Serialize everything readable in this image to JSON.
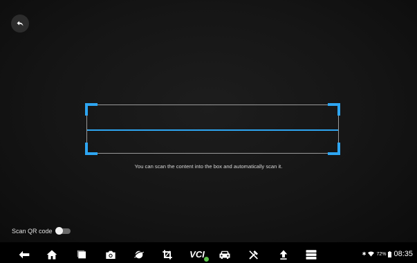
{
  "scanner": {
    "hint": "You can scan the content into the box and automatically scan it.",
    "qr_label": "Scan QR code",
    "qr_enabled": false,
    "accent_color": "#2ea6f2"
  },
  "navbar": {
    "icons": [
      "back-icon",
      "home-icon",
      "recent-apps-icon",
      "camera-icon",
      "browser-icon",
      "screenshot-icon",
      "vci-icon",
      "vehicle-icon",
      "tools-icon",
      "update-icon",
      "menu-icon"
    ],
    "vci_label": "VCI"
  },
  "status_bar": {
    "battery": "72%",
    "time": "08:35",
    "bluetooth": "on",
    "wifi": "on"
  }
}
